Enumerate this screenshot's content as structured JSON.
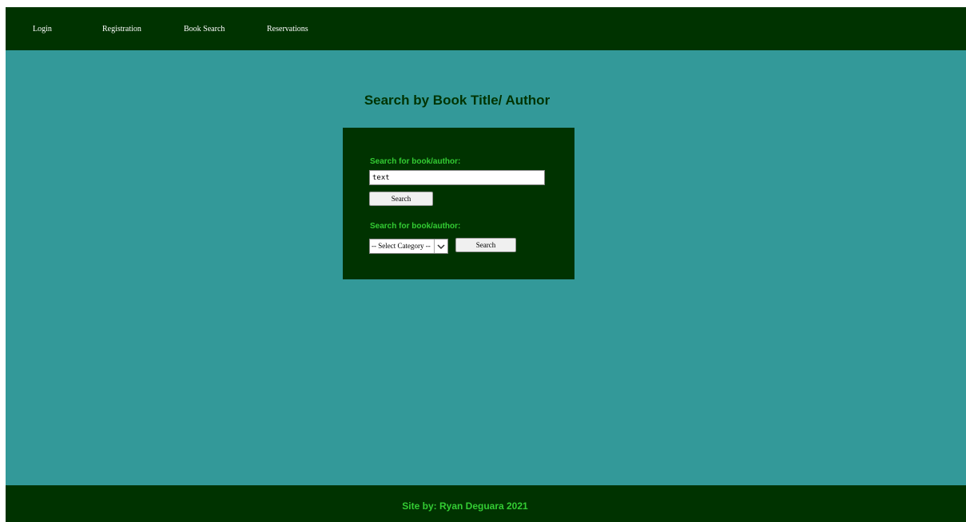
{
  "nav": {
    "items": [
      {
        "label": "Login"
      },
      {
        "label": "Registration"
      },
      {
        "label": "Book Search"
      },
      {
        "label": "Reservations"
      }
    ]
  },
  "main": {
    "title": "Search by Book Title/ Author"
  },
  "search_panel": {
    "text_search": {
      "label": "Search for book/author:",
      "input_value": "text",
      "button_label": "Search"
    },
    "category_search": {
      "label": "Search for book/author:",
      "select_value": "-- Select Category --",
      "button_label": "Search"
    }
  },
  "footer": {
    "text": "Site by: Ryan Deguara 2021"
  },
  "colors": {
    "background": "#339999",
    "dark_green": "#003300",
    "accent_green": "#33cc33"
  }
}
